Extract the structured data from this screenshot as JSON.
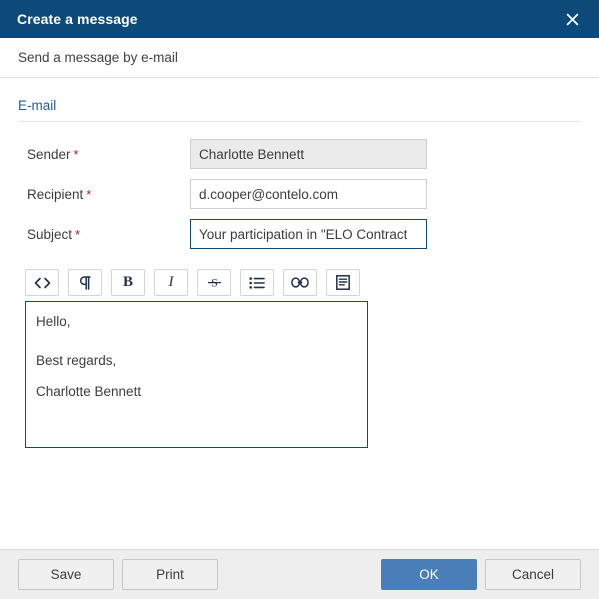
{
  "window": {
    "title": "Create a message",
    "close_icon": "close-icon",
    "subtitle": "Send a message by e-mail"
  },
  "colors": {
    "titlebar_bg": "#0d4a7a",
    "section_heading": "#1f5c99",
    "required_star": "#9b2226",
    "primary_button_bg": "#4a7eb8",
    "field_border_focused": "#0d4a7a",
    "field_border": "#cfcfcf",
    "field_disabled_bg": "#ebebeb",
    "footer_bg": "#eeeeee"
  },
  "form": {
    "section_title": "E-mail",
    "required_marker": "*",
    "fields": [
      {
        "label": "Sender",
        "required": true,
        "value": "Charlotte Bennett",
        "placeholder": "",
        "state": "disabled"
      },
      {
        "label": "Recipient",
        "required": true,
        "value": "d.cooper@contelo.com",
        "placeholder": "",
        "state": "normal"
      },
      {
        "label": "Subject",
        "required": true,
        "value": "Your participation in \"ELO Contract",
        "placeholder": "",
        "state": "focused"
      }
    ]
  },
  "editor": {
    "toolbar": [
      {
        "name": "source-code-icon",
        "title": "Source code",
        "glyph": "<>"
      },
      {
        "name": "paragraph-icon",
        "title": "Paragraph",
        "glyph": "¶"
      },
      {
        "name": "bold-icon",
        "title": "Bold",
        "glyph": "B"
      },
      {
        "name": "italic-icon",
        "title": "Italic",
        "glyph": "I"
      },
      {
        "name": "strikethrough-icon",
        "title": "Strikethrough",
        "glyph": "S"
      },
      {
        "name": "bulleted-list-icon",
        "title": "Bulleted list",
        "glyph": "☰"
      },
      {
        "name": "link-icon",
        "title": "Insert link",
        "glyph": "∞"
      },
      {
        "name": "template-icon",
        "title": "Template",
        "glyph": "▤"
      }
    ],
    "body_lines": [
      "Hello,",
      "",
      "Best regards,",
      "Charlotte Bennett"
    ],
    "body_line_1": "Hello,",
    "body_line_2": "Best regards,",
    "body_line_3": "Charlotte Bennett"
  },
  "footer": {
    "save_label": "Save",
    "print_label": "Print",
    "ok_label": "OK",
    "cancel_label": "Cancel"
  }
}
